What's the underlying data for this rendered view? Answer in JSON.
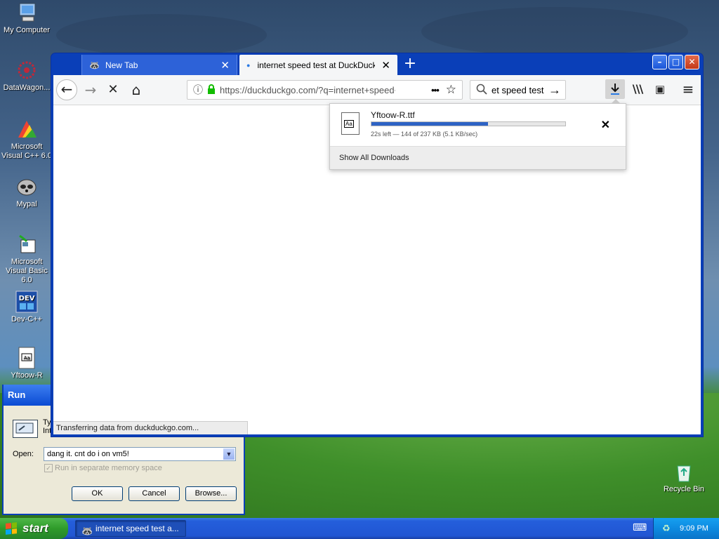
{
  "desktop": {
    "icons": [
      {
        "label": "My Computer"
      },
      {
        "label": "DataWagon..."
      },
      {
        "label": "Microsoft Visual C++ 6.0"
      },
      {
        "label": "Mypal"
      },
      {
        "label": "Microsoft Visual Basic 6.0"
      },
      {
        "label": "Dev-C++"
      },
      {
        "label": "Yftoow-R"
      },
      {
        "label": "Recycle Bin"
      }
    ]
  },
  "browser": {
    "tabs": [
      {
        "label": "New Tab",
        "close": "✕"
      },
      {
        "label": "internet speed test at DuckDuckGo",
        "close": "✕"
      }
    ],
    "new_tab": "+",
    "window_buttons": {
      "minimize": "–",
      "maximize": "□",
      "close": "✕"
    },
    "url": "https://duckduckgo.com/?q=internet+speed+test",
    "search_value": "et speed test",
    "status_text": "Transferring data from duckduckgo.com...",
    "icons": {
      "back": "←",
      "forward": "→",
      "stop": "✕",
      "home": "⌂",
      "info": "ⓘ",
      "lock": "🔒",
      "more": "•••",
      "star": "☆",
      "search": "⚲",
      "go": "→",
      "download": "⬇",
      "library": "\\\\\\",
      "sidebar": "▣",
      "menu": "≡"
    }
  },
  "downloads": {
    "file_name": "Yftoow-R.ttf",
    "progress": 0.6,
    "status": "22s left — 144 of 237 KB (5.1 KB/sec)",
    "show_all": "Show All Downloads",
    "close": "✕"
  },
  "run_dialog": {
    "title": "Run",
    "description_line1": "Ty",
    "description_line2": "Int",
    "open_label": "Open:",
    "open_value": "dang it. cnt do i on vm5!",
    "checkbox_label": "Run in separate memory space",
    "buttons": {
      "ok": "OK",
      "cancel": "Cancel",
      "browse": "Browse..."
    }
  },
  "taskbar": {
    "start_label": "start",
    "task_label": "internet speed test a...",
    "clock": "9:09 PM"
  }
}
